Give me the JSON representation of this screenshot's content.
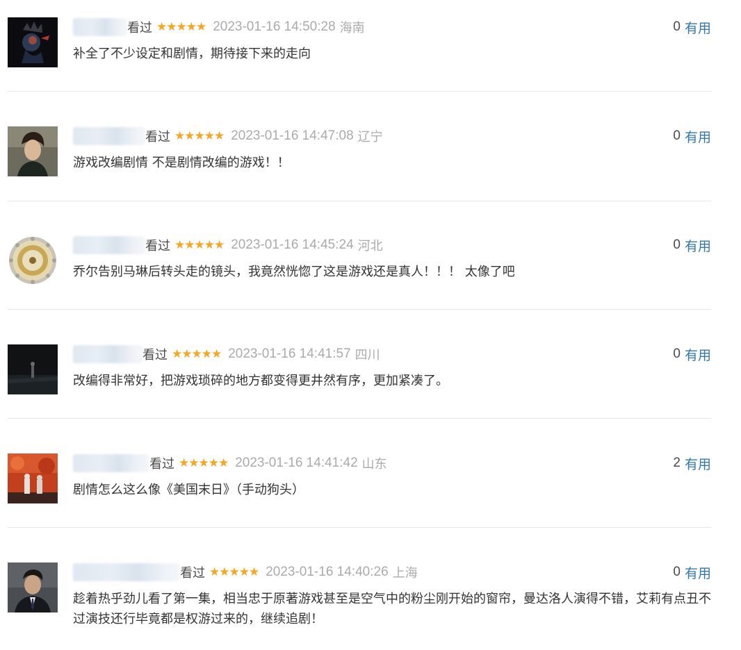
{
  "watched_label": "看过",
  "useful_label": "有用",
  "stars": "★★★★★",
  "comments": [
    {
      "time": "2023-01-16 14:50:28",
      "location": "海南",
      "votes": "0",
      "content": "补全了不少设定和剧情，期待接下来的走向",
      "rating": 5
    },
    {
      "time": "2023-01-16 14:47:08",
      "location": "辽宁",
      "votes": "0",
      "content": "游戏改编剧情 不是剧情改编的游戏！！",
      "rating": 5
    },
    {
      "time": "2023-01-16 14:45:24",
      "location": "河北",
      "votes": "0",
      "content": "乔尔告别马琳后转头走的镜头，我竟然恍惚了这是游戏还是真人！！！ 太像了吧",
      "rating": 5
    },
    {
      "time": "2023-01-16 14:41:57",
      "location": "四川",
      "votes": "0",
      "content": "改编得非常好，把游戏琐碎的地方都变得更井然有序，更加紧凑了。",
      "rating": 5
    },
    {
      "time": "2023-01-16 14:41:42",
      "location": "山东",
      "votes": "2",
      "content": "剧情怎么这么像《美国末日》（手动狗头）",
      "rating": 5
    },
    {
      "time": "2023-01-16 14:40:26",
      "location": "上海",
      "votes": "0",
      "content": "趁着热乎劲儿看了第一集，相当忠于原著游戏甚至是空气中的粉尘刚开始的窗帘，曼达洛人演得不错，艾莉有点丑不过演技还行毕竟都是权游过来的，继续追剧！",
      "rating": 5
    }
  ],
  "colors": {
    "star": "#f5a623",
    "link": "#3377aa",
    "meta": "#aaaaaa",
    "text": "#333333",
    "divider": "#e6e6e6"
  }
}
